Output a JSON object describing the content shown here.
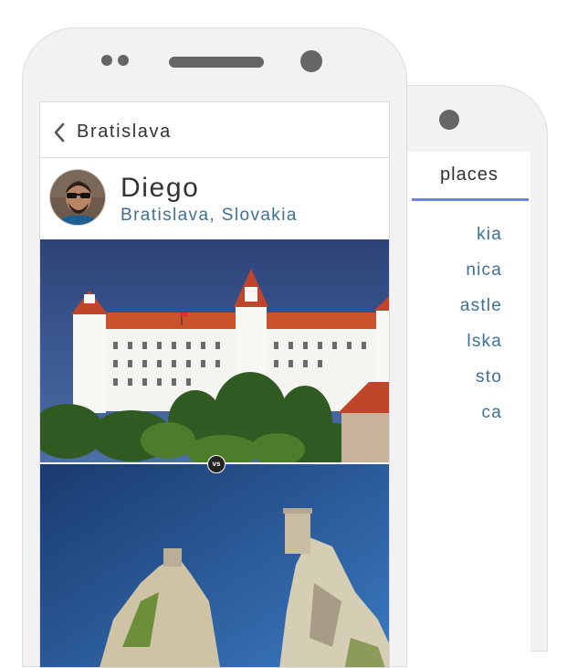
{
  "header": {
    "title": "Bratislava"
  },
  "profile": {
    "name": "Diego",
    "location": "Bratislava, Slovakia"
  },
  "comparison": {
    "vs_label": "vs"
  },
  "back_phone": {
    "tab_label": "places",
    "places": [
      "kia",
      "nica",
      "astle",
      "lska",
      "sto",
      "ca"
    ]
  },
  "colors": {
    "accent": "#6f80e8",
    "link": "#3e6f94",
    "phone_body": "#f2f2f2"
  }
}
